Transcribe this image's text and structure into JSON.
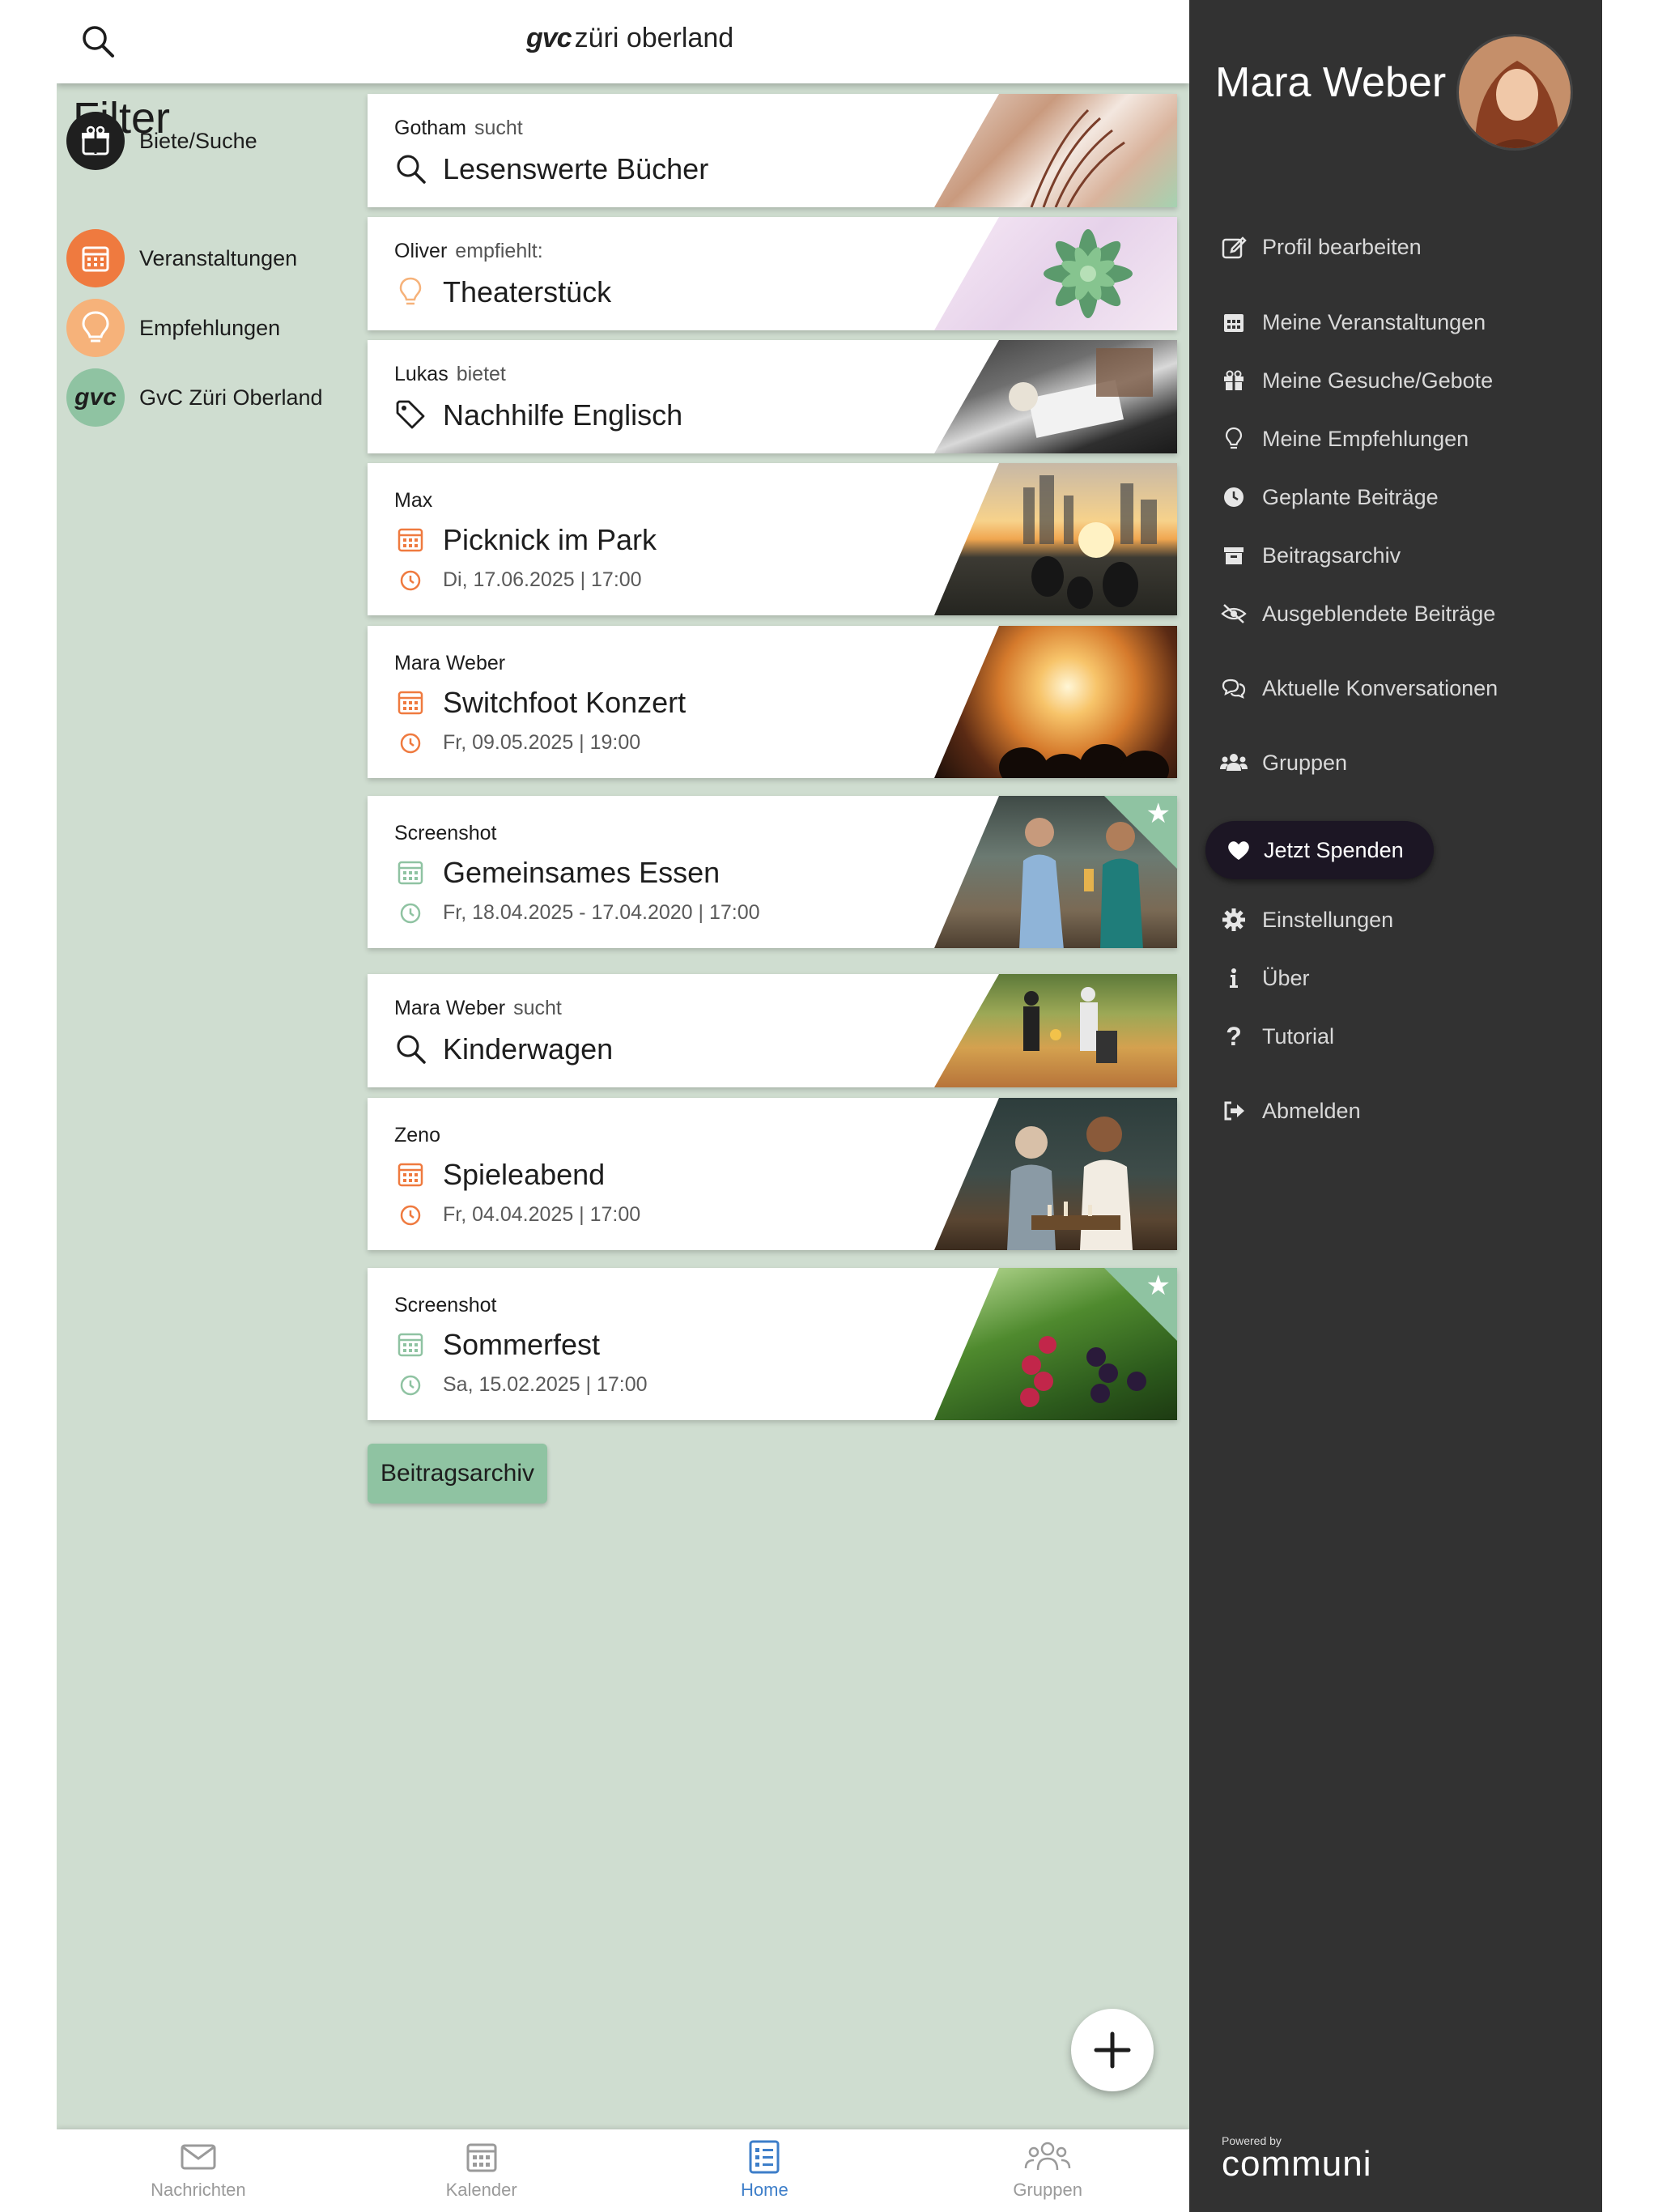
{
  "header": {
    "logo_bold": "gvc",
    "logo_text": "züri oberland"
  },
  "filter": {
    "title": "Filter",
    "items": [
      {
        "label": "Biete/Suche",
        "color": "#1f1f1f"
      },
      {
        "label": "Veranstaltungen",
        "color": "#ef7a3f"
      },
      {
        "label": "Empfehlungen",
        "color": "#f6b27a"
      },
      {
        "label": "GvC Züri Oberland",
        "color": "#8fc3a2"
      }
    ]
  },
  "feed": {
    "cards": [
      {
        "author": "Gotham",
        "verb": "sucht",
        "icon": "search-icon",
        "title": "Lesenswerte Bücher",
        "date": ""
      },
      {
        "author": "Oliver",
        "verb": "empfiehlt:",
        "icon": "lightbulb-icon",
        "title": "Theaterstück",
        "date": ""
      },
      {
        "author": "Lukas",
        "verb": "bietet",
        "icon": "tag-icon",
        "title": "Nachhilfe Englisch",
        "date": ""
      },
      {
        "author": "Max",
        "verb": "",
        "icon": "calendar-icon",
        "title": "Picknick im Park",
        "date": "Di, 17.06.2025 | 17:00"
      },
      {
        "author": "Mara Weber",
        "verb": "",
        "icon": "calendar-icon",
        "title": "Switchfoot Konzert",
        "date": "Fr, 09.05.2025 | 19:00"
      },
      {
        "author": "Screenshot",
        "verb": "",
        "icon": "calendar-icon",
        "title": "Gemeinsames Essen",
        "date": "Fr, 18.04.2025 - 17.04.2020 | 17:00"
      },
      {
        "author": "Mara Weber",
        "verb": "sucht",
        "icon": "search-icon",
        "title": "Kinderwagen",
        "date": ""
      },
      {
        "author": "Zeno",
        "verb": "",
        "icon": "calendar-icon",
        "title": "Spieleabend",
        "date": "Fr, 04.04.2025 | 17:00"
      },
      {
        "author": "Screenshot",
        "verb": "",
        "icon": "calendar-icon",
        "title": "Sommerfest",
        "date": "Sa, 15.02.2025 | 17:00"
      }
    ],
    "archive_button": "Beitragsarchiv"
  },
  "bottom_nav": [
    {
      "label": "Nachrichten",
      "icon": "envelope-icon",
      "active": false
    },
    {
      "label": "Kalender",
      "icon": "calendar-icon",
      "active": false
    },
    {
      "label": "Home",
      "icon": "list-icon",
      "active": true
    },
    {
      "label": "Gruppen",
      "icon": "groups-icon",
      "active": false
    }
  ],
  "drawer": {
    "user_name": "Mara Weber",
    "menu": [
      {
        "label": "Profil bearbeiten",
        "icon": "edit-icon"
      },
      {
        "label": "Meine Veranstaltungen",
        "icon": "calendar-icon"
      },
      {
        "label": "Meine Gesuche/Gebote",
        "icon": "gift-icon"
      },
      {
        "label": "Meine Empfehlungen",
        "icon": "lightbulb-icon"
      },
      {
        "label": "Geplante Beiträge",
        "icon": "clock-icon"
      },
      {
        "label": "Beitragsarchiv",
        "icon": "archive-icon"
      },
      {
        "label": "Ausgeblendete Beiträge",
        "icon": "eye-slash-icon"
      },
      {
        "label": "Aktuelle Konversationen",
        "icon": "chat-icon"
      },
      {
        "label": "Gruppen",
        "icon": "users-icon"
      }
    ],
    "donate_button": "Jetzt Spenden",
    "menu_bottom": [
      {
        "label": "Einstellungen",
        "icon": "gear-icon"
      },
      {
        "label": "Über",
        "icon": "info-icon"
      },
      {
        "label": "Tutorial",
        "icon": "question-icon"
      },
      {
        "label": "Abmelden",
        "icon": "logout-icon"
      }
    ],
    "powered_by": "Powered by",
    "powered_brand": "communi"
  },
  "colors": {
    "background": "#cfddd0",
    "drawer": "#323232",
    "accent_orange": "#ef7a3f",
    "accent_green": "#8fc3a2",
    "nav_active": "#3d7ec9"
  }
}
